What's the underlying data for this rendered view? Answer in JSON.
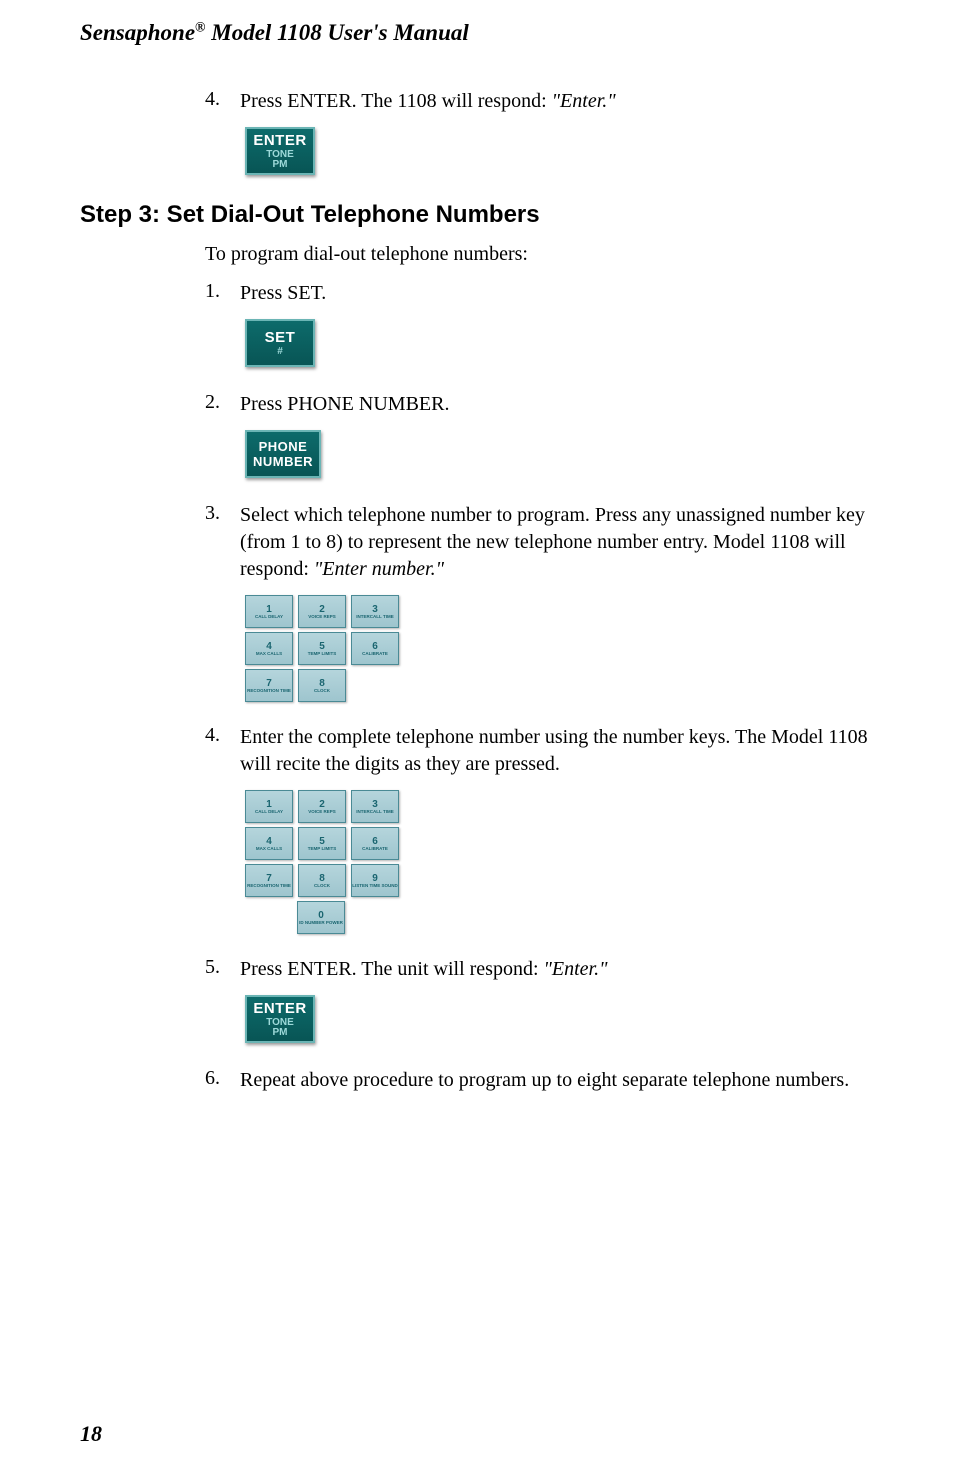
{
  "header": {
    "product": "Sensaphone",
    "model": "Model 1108 User's Manual"
  },
  "top_step": {
    "num": "4.",
    "text_a": "Press ENTER. The 1108 will respond: ",
    "text_q": "\"Enter.\""
  },
  "enter_key": {
    "main": "ENTER",
    "sub1": "TONE",
    "sub2": "PM"
  },
  "heading": "Step 3:  Set Dial-Out Telephone Numbers",
  "intro": "To program dial-out telephone numbers:",
  "steps": {
    "s1": {
      "num": "1.",
      "text": "Press SET."
    },
    "s2": {
      "num": "2.",
      "text": "Press PHONE NUMBER."
    },
    "s3": {
      "num": "3.",
      "text_a": "Select which telephone number to program. Press any unassigned number key (from 1 to 8) to represent the new telephone number entry. Model 1108 will respond: ",
      "text_q": "\"Enter number.\""
    },
    "s4": {
      "num": "4.",
      "text": "Enter the complete telephone number using the number keys. The Model 1108 will recite the digits as they are pressed."
    },
    "s5": {
      "num": "5.",
      "text_a": "Press ENTER. The unit will respond: ",
      "text_q": "\"Enter.\""
    },
    "s6": {
      "num": "6.",
      "text": "Repeat above procedure to program up to eight separate telephone numbers."
    }
  },
  "set_key": {
    "main": "SET",
    "sub": "#"
  },
  "phone_key": {
    "main1": "PHONE",
    "main2": "NUMBER"
  },
  "keypad": {
    "k1": {
      "n": "1",
      "l": "CALL DELAY"
    },
    "k2": {
      "n": "2",
      "l": "VOICE REPS"
    },
    "k3": {
      "n": "3",
      "l": "INTERCALL TIME"
    },
    "k4": {
      "n": "4",
      "l": "MAX CALLS"
    },
    "k5": {
      "n": "5",
      "l": "TEMP LIMITS"
    },
    "k6": {
      "n": "6",
      "l": "CALIBRATE"
    },
    "k7": {
      "n": "7",
      "l": "RECOGNITION TIME"
    },
    "k8": {
      "n": "8",
      "l": "CLOCK"
    },
    "k9": {
      "n": "9",
      "l": "LISTEN TIME SOUND"
    },
    "k0": {
      "n": "0",
      "l": "ID NUMBER POWER"
    }
  },
  "page_number": "18"
}
